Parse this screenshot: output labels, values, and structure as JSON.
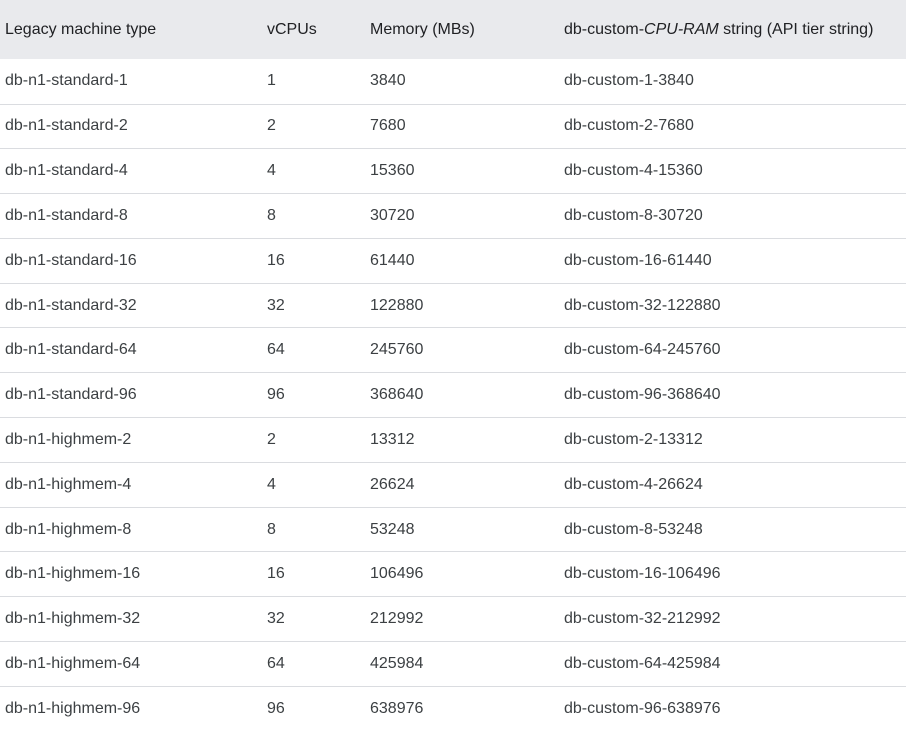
{
  "table": {
    "headers": {
      "machine_type": "Legacy machine type",
      "vcpus": "vCPUs",
      "memory": "Memory (MBs)",
      "api_prefix": "db-custom-",
      "api_italic": "CPU-RAM",
      "api_suffix": " string (API tier string)"
    },
    "rows": [
      {
        "machine_type": "db-n1-standard-1",
        "vcpus": "1",
        "memory": "3840",
        "api": "db-custom-1-3840"
      },
      {
        "machine_type": "db-n1-standard-2",
        "vcpus": "2",
        "memory": "7680",
        "api": "db-custom-2-7680"
      },
      {
        "machine_type": "db-n1-standard-4",
        "vcpus": "4",
        "memory": "15360",
        "api": "db-custom-4-15360"
      },
      {
        "machine_type": "db-n1-standard-8",
        "vcpus": "8",
        "memory": "30720",
        "api": "db-custom-8-30720"
      },
      {
        "machine_type": "db-n1-standard-16",
        "vcpus": "16",
        "memory": "61440",
        "api": "db-custom-16-61440"
      },
      {
        "machine_type": "db-n1-standard-32",
        "vcpus": "32",
        "memory": "122880",
        "api": "db-custom-32-122880"
      },
      {
        "machine_type": "db-n1-standard-64",
        "vcpus": "64",
        "memory": "245760",
        "api": "db-custom-64-245760"
      },
      {
        "machine_type": "db-n1-standard-96",
        "vcpus": "96",
        "memory": "368640",
        "api": "db-custom-96-368640"
      },
      {
        "machine_type": "db-n1-highmem-2",
        "vcpus": "2",
        "memory": "13312",
        "api": "db-custom-2-13312"
      },
      {
        "machine_type": "db-n1-highmem-4",
        "vcpus": "4",
        "memory": "26624",
        "api": "db-custom-4-26624"
      },
      {
        "machine_type": "db-n1-highmem-8",
        "vcpus": "8",
        "memory": "53248",
        "api": "db-custom-8-53248"
      },
      {
        "machine_type": "db-n1-highmem-16",
        "vcpus": "16",
        "memory": "106496",
        "api": "db-custom-16-106496"
      },
      {
        "machine_type": "db-n1-highmem-32",
        "vcpus": "32",
        "memory": "212992",
        "api": "db-custom-32-212992"
      },
      {
        "machine_type": "db-n1-highmem-64",
        "vcpus": "64",
        "memory": "425984",
        "api": "db-custom-64-425984"
      },
      {
        "machine_type": "db-n1-highmem-96",
        "vcpus": "96",
        "memory": "638976",
        "api": "db-custom-96-638976"
      }
    ]
  }
}
